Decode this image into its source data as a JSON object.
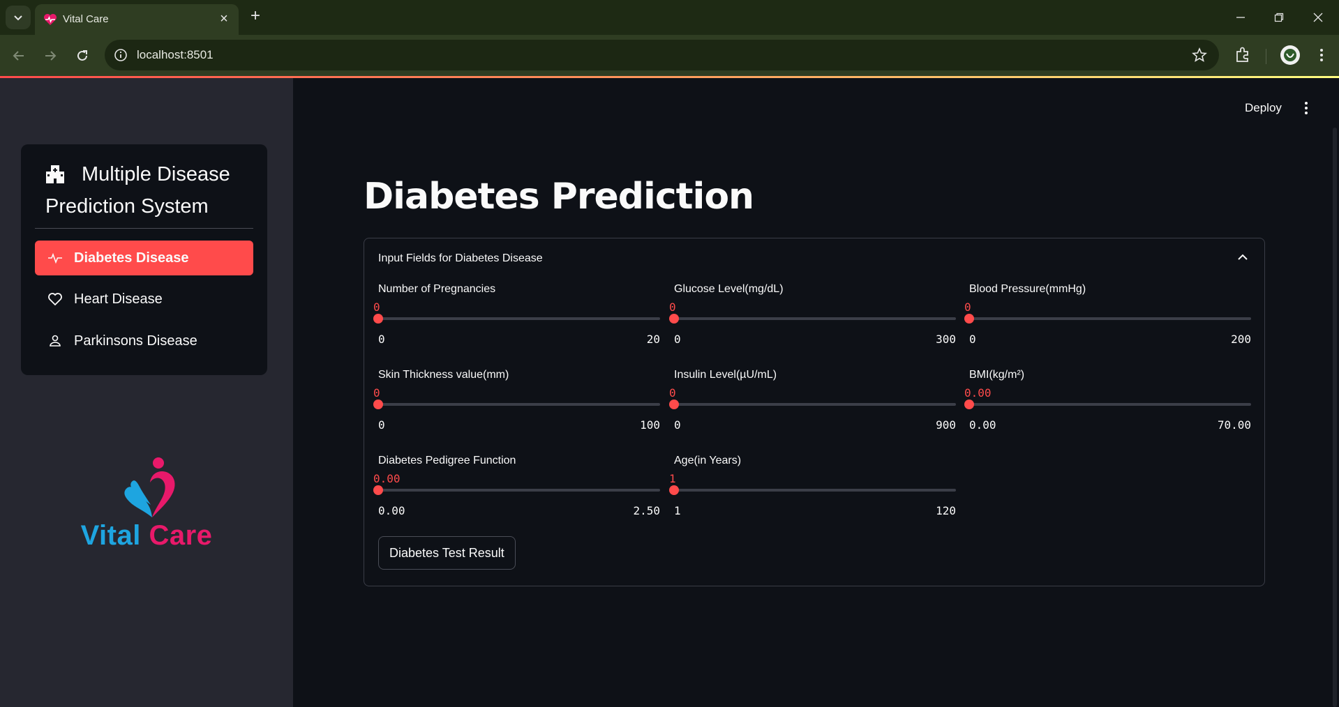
{
  "browser": {
    "tab_title": "Vital Care",
    "url": "localhost:8501"
  },
  "sidebar": {
    "menu_title": "Multiple Disease Prediction System",
    "items": [
      {
        "label": "Diabetes Disease",
        "icon": "activity-icon",
        "active": true
      },
      {
        "label": "Heart Disease",
        "icon": "heart-icon",
        "active": false
      },
      {
        "label": "Parkinsons Disease",
        "icon": "person-icon",
        "active": false
      }
    ],
    "logo": {
      "text_1": "Vital",
      "text_2": "Care"
    }
  },
  "header": {
    "deploy_label": "Deploy"
  },
  "main": {
    "title": "Diabetes Prediction",
    "expander_title": "Input Fields for Diabetes Disease",
    "sliders": [
      {
        "label": "Number of Pregnancies",
        "value": "0",
        "min": "0",
        "max": "20"
      },
      {
        "label": "Glucose Level(mg/dL)",
        "value": "0",
        "min": "0",
        "max": "300"
      },
      {
        "label": "Blood Pressure(mmHg)",
        "value": "0",
        "min": "0",
        "max": "200"
      },
      {
        "label": "Skin Thickness value(mm)",
        "value": "0",
        "min": "0",
        "max": "100"
      },
      {
        "label": "Insulin Level(µU/mL)",
        "value": "0",
        "min": "0",
        "max": "900"
      },
      {
        "label": "BMI(kg/m²)",
        "value": "0.00",
        "min": "0.00",
        "max": "70.00"
      },
      {
        "label": "Diabetes Pedigree Function",
        "value": "0.00",
        "min": "0.00",
        "max": "2.50"
      },
      {
        "label": "Age(in Years)",
        "value": "1",
        "min": "1",
        "max": "120"
      }
    ],
    "button_label": "Diabetes Test Result"
  },
  "colors": {
    "accent": "#ff4b4b",
    "logo_blue": "#1ea5e0",
    "logo_pink": "#e8196a"
  }
}
